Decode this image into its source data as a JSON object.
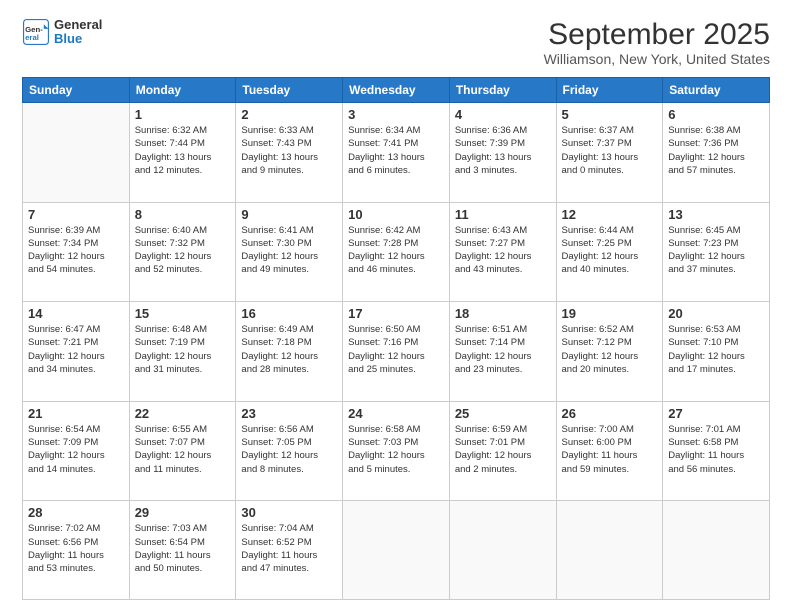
{
  "logo": {
    "line1": "General",
    "line2": "Blue"
  },
  "title": "September 2025",
  "subtitle": "Williamson, New York, United States",
  "weekdays": [
    "Sunday",
    "Monday",
    "Tuesday",
    "Wednesday",
    "Thursday",
    "Friday",
    "Saturday"
  ],
  "weeks": [
    [
      {
        "day": "",
        "info": ""
      },
      {
        "day": "1",
        "info": "Sunrise: 6:32 AM\nSunset: 7:44 PM\nDaylight: 13 hours\nand 12 minutes."
      },
      {
        "day": "2",
        "info": "Sunrise: 6:33 AM\nSunset: 7:43 PM\nDaylight: 13 hours\nand 9 minutes."
      },
      {
        "day": "3",
        "info": "Sunrise: 6:34 AM\nSunset: 7:41 PM\nDaylight: 13 hours\nand 6 minutes."
      },
      {
        "day": "4",
        "info": "Sunrise: 6:36 AM\nSunset: 7:39 PM\nDaylight: 13 hours\nand 3 minutes."
      },
      {
        "day": "5",
        "info": "Sunrise: 6:37 AM\nSunset: 7:37 PM\nDaylight: 13 hours\nand 0 minutes."
      },
      {
        "day": "6",
        "info": "Sunrise: 6:38 AM\nSunset: 7:36 PM\nDaylight: 12 hours\nand 57 minutes."
      }
    ],
    [
      {
        "day": "7",
        "info": "Sunrise: 6:39 AM\nSunset: 7:34 PM\nDaylight: 12 hours\nand 54 minutes."
      },
      {
        "day": "8",
        "info": "Sunrise: 6:40 AM\nSunset: 7:32 PM\nDaylight: 12 hours\nand 52 minutes."
      },
      {
        "day": "9",
        "info": "Sunrise: 6:41 AM\nSunset: 7:30 PM\nDaylight: 12 hours\nand 49 minutes."
      },
      {
        "day": "10",
        "info": "Sunrise: 6:42 AM\nSunset: 7:28 PM\nDaylight: 12 hours\nand 46 minutes."
      },
      {
        "day": "11",
        "info": "Sunrise: 6:43 AM\nSunset: 7:27 PM\nDaylight: 12 hours\nand 43 minutes."
      },
      {
        "day": "12",
        "info": "Sunrise: 6:44 AM\nSunset: 7:25 PM\nDaylight: 12 hours\nand 40 minutes."
      },
      {
        "day": "13",
        "info": "Sunrise: 6:45 AM\nSunset: 7:23 PM\nDaylight: 12 hours\nand 37 minutes."
      }
    ],
    [
      {
        "day": "14",
        "info": "Sunrise: 6:47 AM\nSunset: 7:21 PM\nDaylight: 12 hours\nand 34 minutes."
      },
      {
        "day": "15",
        "info": "Sunrise: 6:48 AM\nSunset: 7:19 PM\nDaylight: 12 hours\nand 31 minutes."
      },
      {
        "day": "16",
        "info": "Sunrise: 6:49 AM\nSunset: 7:18 PM\nDaylight: 12 hours\nand 28 minutes."
      },
      {
        "day": "17",
        "info": "Sunrise: 6:50 AM\nSunset: 7:16 PM\nDaylight: 12 hours\nand 25 minutes."
      },
      {
        "day": "18",
        "info": "Sunrise: 6:51 AM\nSunset: 7:14 PM\nDaylight: 12 hours\nand 23 minutes."
      },
      {
        "day": "19",
        "info": "Sunrise: 6:52 AM\nSunset: 7:12 PM\nDaylight: 12 hours\nand 20 minutes."
      },
      {
        "day": "20",
        "info": "Sunrise: 6:53 AM\nSunset: 7:10 PM\nDaylight: 12 hours\nand 17 minutes."
      }
    ],
    [
      {
        "day": "21",
        "info": "Sunrise: 6:54 AM\nSunset: 7:09 PM\nDaylight: 12 hours\nand 14 minutes."
      },
      {
        "day": "22",
        "info": "Sunrise: 6:55 AM\nSunset: 7:07 PM\nDaylight: 12 hours\nand 11 minutes."
      },
      {
        "day": "23",
        "info": "Sunrise: 6:56 AM\nSunset: 7:05 PM\nDaylight: 12 hours\nand 8 minutes."
      },
      {
        "day": "24",
        "info": "Sunrise: 6:58 AM\nSunset: 7:03 PM\nDaylight: 12 hours\nand 5 minutes."
      },
      {
        "day": "25",
        "info": "Sunrise: 6:59 AM\nSunset: 7:01 PM\nDaylight: 12 hours\nand 2 minutes."
      },
      {
        "day": "26",
        "info": "Sunrise: 7:00 AM\nSunset: 6:00 PM\nDaylight: 11 hours\nand 59 minutes."
      },
      {
        "day": "27",
        "info": "Sunrise: 7:01 AM\nSunset: 6:58 PM\nDaylight: 11 hours\nand 56 minutes."
      }
    ],
    [
      {
        "day": "28",
        "info": "Sunrise: 7:02 AM\nSunset: 6:56 PM\nDaylight: 11 hours\nand 53 minutes."
      },
      {
        "day": "29",
        "info": "Sunrise: 7:03 AM\nSunset: 6:54 PM\nDaylight: 11 hours\nand 50 minutes."
      },
      {
        "day": "30",
        "info": "Sunrise: 7:04 AM\nSunset: 6:52 PM\nDaylight: 11 hours\nand 47 minutes."
      },
      {
        "day": "",
        "info": ""
      },
      {
        "day": "",
        "info": ""
      },
      {
        "day": "",
        "info": ""
      },
      {
        "day": "",
        "info": ""
      }
    ]
  ]
}
